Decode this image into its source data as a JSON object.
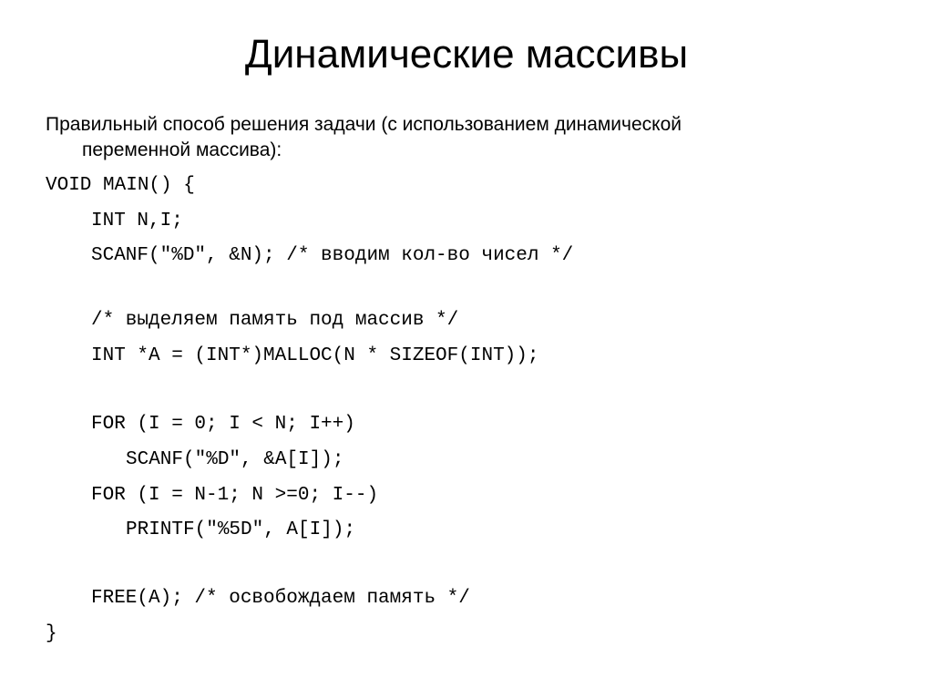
{
  "title": "Динамические массивы",
  "intro": {
    "line1": "Правильный способ решения задачи (с использованием динамической",
    "line2": "переменной массива):"
  },
  "code": {
    "l1": "VOID MAIN() {",
    "l2": "INT N,I;",
    "l3": "SCANF(\"%D\", &N); /* вводим кол-во чисел */",
    "l4": "/* выделяем память под массив */",
    "l5": "INT *A = (INT*)MALLOC(N * SIZEOF(INT));",
    "l6": "FOR (I = 0; I < N; I++)",
    "l7": "SCANF(\"%D\", &A[I]);",
    "l8": "FOR (I = N-1; N >=0; I--)",
    "l9": "PRINTF(\"%5D\", A[I]);",
    "l10": "FREE(A); /* освобождаем память */",
    "l11": "}"
  }
}
